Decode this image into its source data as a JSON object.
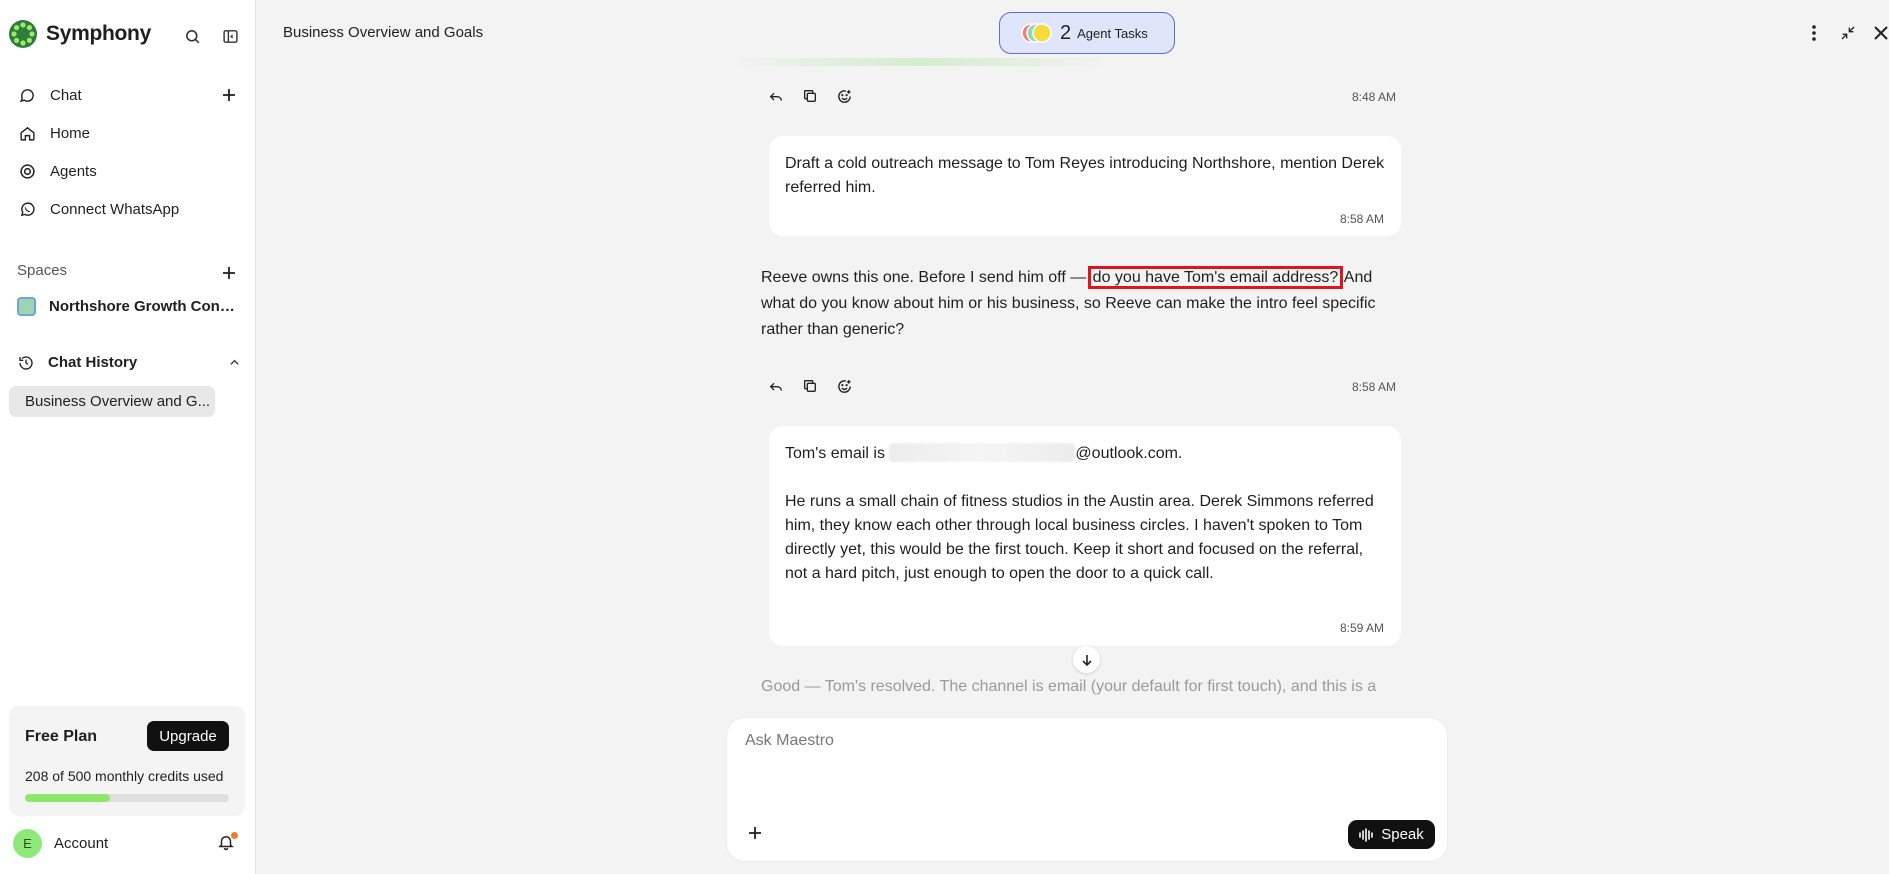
{
  "app": {
    "name": "Symphony"
  },
  "sidebar": {
    "nav": [
      {
        "label": "Chat",
        "icon": "chat-bubble-icon"
      },
      {
        "label": "Home",
        "icon": "home-icon"
      },
      {
        "label": "Agents",
        "icon": "agents-icon"
      },
      {
        "label": "Connect WhatsApp",
        "icon": "whatsapp-icon"
      }
    ],
    "spaces_label": "Spaces",
    "spaces": [
      {
        "name": "Northshore Growth Cons..."
      }
    ],
    "history_label": "Chat History",
    "history": [
      {
        "label": "Business Overview and G..."
      }
    ],
    "plan": {
      "title": "Free Plan",
      "upgrade_label": "Upgrade",
      "credits_text": "208 of 500 monthly credits used",
      "credits_used": 208,
      "credits_total": 500
    },
    "account": {
      "initial": "E",
      "label": "Account",
      "has_notification": true
    }
  },
  "header": {
    "title": "Business Overview and Goals",
    "agent_tasks": {
      "count": "2",
      "label": "Agent Tasks"
    }
  },
  "messages": [
    {
      "role": "assistant-actions",
      "time": "8:48 AM"
    },
    {
      "role": "user",
      "text": "Draft a cold outreach message to Tom Reyes introducing Northshore, mention Derek referred him.",
      "time": "8:58 AM"
    },
    {
      "role": "assistant",
      "text_before": "Reeve owns this one. Before I send him off —",
      "text_highlight": "do you have Tom's email address?",
      "text_after": "And what do you know about him or his business, so Reeve can make the intro feel specific rather than generic?",
      "time": "8:58 AM"
    },
    {
      "role": "user",
      "text_email_prefix": "Tom's email is",
      "text_email_suffix": "@outlook.com.",
      "text_body": "He runs a small chain of fitness studios in the Austin area. Derek Simmons referred him, they know each other through local business circles. I haven't spoken to Tom directly yet, this would be the first touch. Keep it short and focused on the referral, not a hard pitch, just enough to open the door to a quick call.",
      "time": "8:59 AM"
    },
    {
      "role": "assistant-partial",
      "text": "Good — Tom's resolved. The channel is email (your default for first touch), and this is a"
    }
  ],
  "composer": {
    "placeholder": "Ask Maestro",
    "speak_label": "Speak"
  },
  "colors": {
    "highlight": "#e0141a",
    "accent_green": "#8ee66a",
    "agent_tasks_bg": "#dfe6fb"
  }
}
